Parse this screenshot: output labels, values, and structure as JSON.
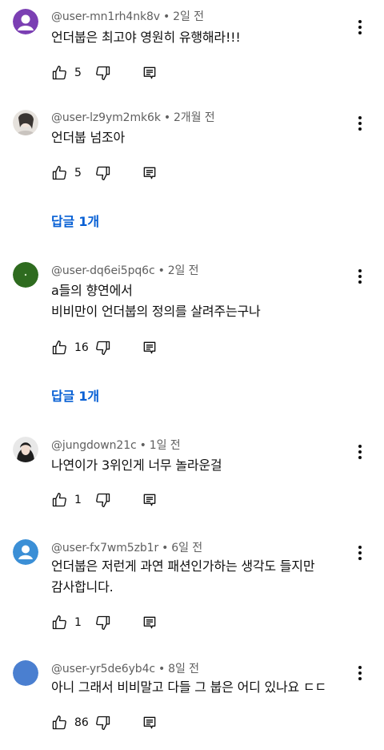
{
  "comments": [
    {
      "handle": "@user-mn1rh4nk8v",
      "age": "2일 전",
      "text": "언더붑은 최고야 영원히 유행해라!!!",
      "likes": "5",
      "avatar_color": "#7b3fb3"
    },
    {
      "handle": "@user-lz9ym2mk6k",
      "age": "2개월 전",
      "text": "언더붑 넘조아",
      "likes": "5",
      "replies": "답글 1개",
      "avatar_color": "#d8d4d0"
    },
    {
      "handle": "@user-dq6ei5pq6c",
      "age": "2일 전",
      "text": "a들의 향연에서\n비비만이 언더붑의 정의를 살려주는구나",
      "likes": "16",
      "replies": "답글 1개",
      "avatar_color": "#2e6b1f"
    },
    {
      "handle": "@jungdown21c",
      "age": "1일 전",
      "text": "나연이가 3위인게 너무 놀라운걸",
      "likes": "1",
      "avatar_color": "#2a2a2a"
    },
    {
      "handle": "@user-fx7wm5zb1r",
      "age": "6일 전",
      "text": "언더붑은 저런게 과연 패션인가하는 생각도 들지만\n감사합니다.",
      "likes": "1",
      "avatar_color": "#3b8fd6"
    },
    {
      "handle": "@user-yr5de6yb4c",
      "age": "8일 전",
      "text": "아니 그래서 비비말고 다들 그 붑은 어디 있나요 ㄷㄷ",
      "likes": "86",
      "avatar_color": "#4a7fd0"
    }
  ],
  "meta_separator": "•"
}
